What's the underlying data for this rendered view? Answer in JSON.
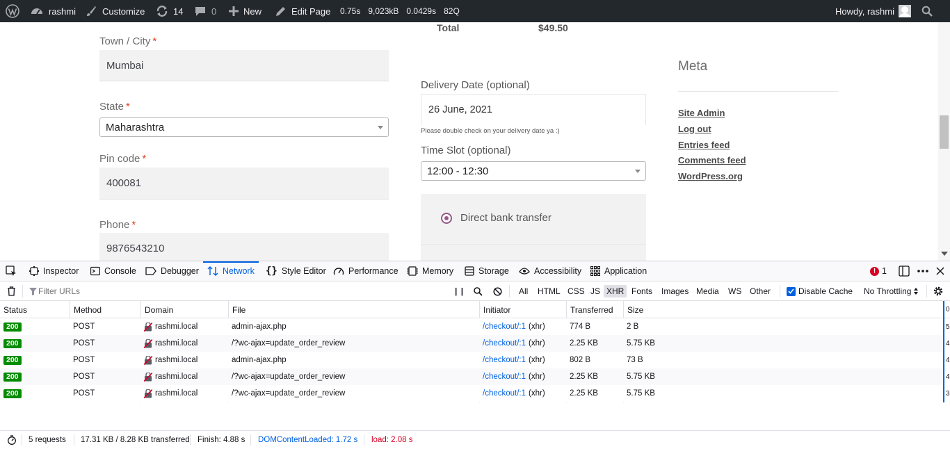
{
  "adminbar": {
    "site_name": "rashmi",
    "customize": "Customize",
    "updates_count": "14",
    "comments_count": "0",
    "new_label": "New",
    "edit_page": "Edit Page",
    "perf_time": "0.75s",
    "perf_memory": "9,023kB",
    "perf_query_time": "0.0429s",
    "perf_queries": "82Q",
    "howdy": "Howdy, rashmi"
  },
  "checkout": {
    "total_label": "Total",
    "total_value": "$49.50",
    "city": {
      "label": "Town / City",
      "required": "*",
      "value": "Mumbai"
    },
    "state": {
      "label": "State",
      "required": "*",
      "value": "Maharashtra"
    },
    "pincode": {
      "label": "Pin code",
      "required": "*",
      "value": "400081"
    },
    "phone": {
      "label": "Phone",
      "required": "*",
      "value": "9876543210"
    },
    "delivery_date": {
      "label": "Delivery Date (optional)",
      "value": "26 June, 2021",
      "note": "Please double check on your delivery date ya :)"
    },
    "time_slot": {
      "label": "Time Slot (optional)",
      "value": "12:00 - 12:30"
    },
    "payment": {
      "method": "Direct bank transfer"
    }
  },
  "sidebar": {
    "title": "Meta",
    "links": [
      "Site Admin",
      "Log out",
      "Entries feed",
      "Comments feed",
      "WordPress.org"
    ]
  },
  "devtools": {
    "tabs": [
      "Inspector",
      "Console",
      "Debugger",
      "Network",
      "Style Editor",
      "Performance",
      "Memory",
      "Storage",
      "Accessibility",
      "Application"
    ],
    "active_tab": "Network",
    "error_count": "1",
    "filter_placeholder": "Filter URLs",
    "pause_label": "| |",
    "filter_types": [
      "All",
      "HTML",
      "CSS",
      "JS",
      "XHR",
      "Fonts",
      "Images",
      "Media",
      "WS",
      "Other"
    ],
    "active_filter": "XHR",
    "disable_cache_label": "Disable Cache",
    "throttling_label": "No Throttling",
    "columns": [
      "Status",
      "Method",
      "Domain",
      "File",
      "Initiator",
      "Transferred",
      "Size"
    ],
    "requests": [
      {
        "status": "200",
        "method": "POST",
        "domain": "rashmi.local",
        "file": "admin-ajax.php",
        "initiator": "/checkout/:1",
        "initiator_type": "(xhr)",
        "transferred": "774 B",
        "size": "2 B",
        "waterfall": "5"
      },
      {
        "status": "200",
        "method": "POST",
        "domain": "rashmi.local",
        "file": "/?wc-ajax=update_order_review",
        "initiator": "/checkout/:1",
        "initiator_type": "(xhr)",
        "transferred": "2.25 KB",
        "size": "5.75 KB",
        "waterfall": "4"
      },
      {
        "status": "200",
        "method": "POST",
        "domain": "rashmi.local",
        "file": "admin-ajax.php",
        "initiator": "/checkout/:1",
        "initiator_type": "(xhr)",
        "transferred": "802 B",
        "size": "73 B",
        "waterfall": "4"
      },
      {
        "status": "200",
        "method": "POST",
        "domain": "rashmi.local",
        "file": "/?wc-ajax=update_order_review",
        "initiator": "/checkout/:1",
        "initiator_type": "(xhr)",
        "transferred": "2.25 KB",
        "size": "5.75 KB",
        "waterfall": "4"
      },
      {
        "status": "200",
        "method": "POST",
        "domain": "rashmi.local",
        "file": "/?wc-ajax=update_order_review",
        "initiator": "/checkout/:1",
        "initiator_type": "(xhr)",
        "transferred": "2.25 KB",
        "size": "5.75 KB",
        "waterfall": "3"
      }
    ],
    "waterfall_header": "0",
    "summary": {
      "requests": "5 requests",
      "transferred": "17.31 KB / 8.28 KB transferred",
      "finish": "Finish: 4.88 s",
      "dom_content_loaded": "DOMContentLoaded: 1.72 s",
      "load": "load: 2.08 s"
    }
  },
  "colors": {
    "adminbar_bg": "#23282d",
    "required": "#e2401c",
    "active_tab": "#0061e0",
    "status_ok": "#058b00",
    "dom_content_loaded": "#0061e0",
    "load": "#d70022",
    "radio": "#96588a"
  }
}
